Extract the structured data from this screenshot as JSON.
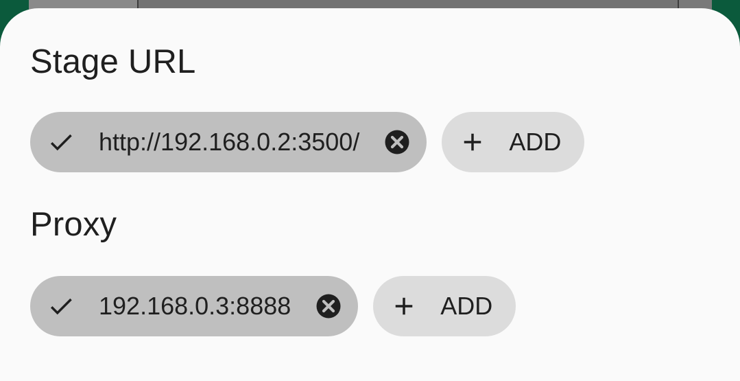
{
  "sections": [
    {
      "title": "Stage URL",
      "chips": [
        {
          "label": "http://192.168.0.2:3500/",
          "selected": true
        }
      ],
      "add_label": "ADD"
    },
    {
      "title": "Proxy",
      "chips": [
        {
          "label": "192.168.0.3:8888",
          "selected": true
        }
      ],
      "add_label": "ADD"
    }
  ],
  "icons": {
    "selected": "check-icon",
    "remove": "close-circle-icon",
    "add": "plus-icon"
  },
  "colors": {
    "selected_chip": "#bfbfbf",
    "add_chip": "#dcdcdc",
    "sheet_background": "#fafafa",
    "app_background": "#0b5a3c",
    "text": "#1f1f1f"
  }
}
